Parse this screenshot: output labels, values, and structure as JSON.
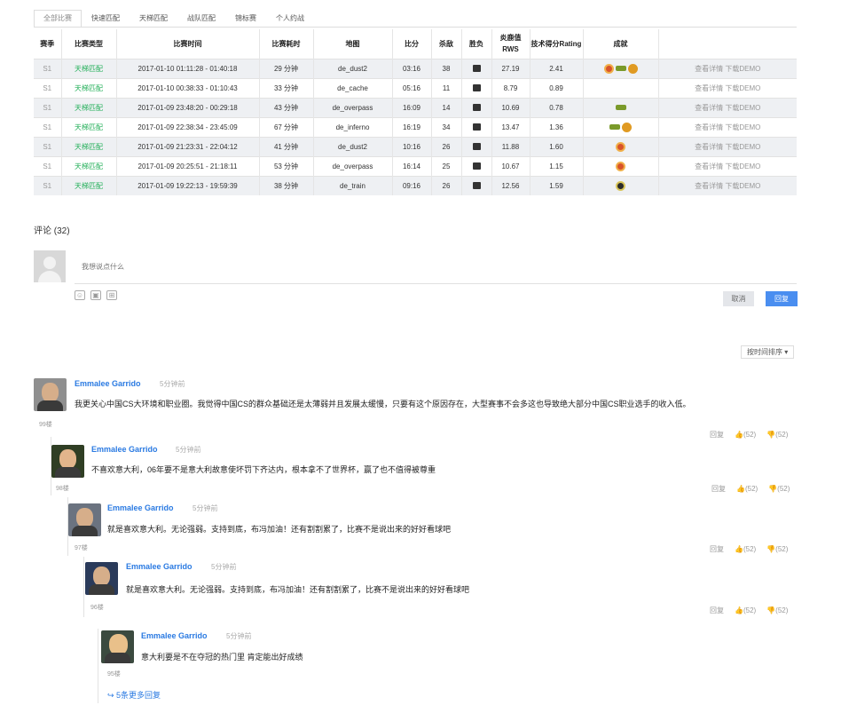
{
  "tabs": [
    "全部比赛",
    "快速匹配",
    "天梯匹配",
    "战队匹配",
    "锦标赛",
    "个人约战"
  ],
  "table": {
    "headers": [
      "赛季",
      "比赛类型",
      "比赛时间",
      "比赛耗时",
      "地图",
      "比分",
      "杀敌",
      "胜负",
      "炎鹿值RWS",
      "技术得分Rating",
      "成就",
      ""
    ],
    "rows": [
      {
        "season": "S1",
        "type": "天梯匹配",
        "time": "2017-01-10 01:11:28 - 01:40:18",
        "duration": "29 分钟",
        "map": "de_dust2",
        "score": "03:16",
        "kills": "38",
        "result": "car",
        "rws": "27.19",
        "rating": "2.41",
        "badges": [
          "red",
          "knife",
          "gold"
        ],
        "links": "查看详情  下载DEMO"
      },
      {
        "season": "S1",
        "type": "天梯匹配",
        "time": "2017-01-10 00:38:33 - 01:10:43",
        "duration": "33 分钟",
        "map": "de_cache",
        "score": "05:16",
        "kills": "11",
        "result": "car",
        "rws": "8.79",
        "rating": "0.89",
        "badges": [],
        "links": "查看详情  下载DEMO"
      },
      {
        "season": "S1",
        "type": "天梯匹配",
        "time": "2017-01-09 23:48:20 - 00:29:18",
        "duration": "43 分钟",
        "map": "de_overpass",
        "score": "16:09",
        "kills": "14",
        "result": "car",
        "rws": "10.69",
        "rating": "0.78",
        "badges": [
          "knife"
        ],
        "links": "查看详情  下载DEMO"
      },
      {
        "season": "S1",
        "type": "天梯匹配",
        "time": "2017-01-09 22:38:34 - 23:45:09",
        "duration": "67 分钟",
        "map": "de_inferno",
        "score": "16:19",
        "kills": "34",
        "result": "car",
        "rws": "13.47",
        "rating": "1.36",
        "badges": [
          "knife",
          "gold"
        ],
        "links": "查看详情  下载DEMO"
      },
      {
        "season": "S1",
        "type": "天梯匹配",
        "time": "2017-01-09 21:23:31 - 22:04:12",
        "duration": "41 分钟",
        "map": "de_dust2",
        "score": "10:16",
        "kills": "26",
        "result": "car",
        "rws": "11.88",
        "rating": "1.60",
        "badges": [
          "red"
        ],
        "links": "查看详情  下载DEMO"
      },
      {
        "season": "S1",
        "type": "天梯匹配",
        "time": "2017-01-09 20:25:51 - 21:18:11",
        "duration": "53 分钟",
        "map": "de_overpass",
        "score": "16:14",
        "kills": "25",
        "result": "car",
        "rws": "10.67",
        "rating": "1.15",
        "badges": [
          "red"
        ],
        "links": "查看详情  下载DEMO"
      },
      {
        "season": "S1",
        "type": "天梯匹配",
        "time": "2017-01-09 19:22:13 - 19:59:39",
        "duration": "38 分钟",
        "map": "de_train",
        "score": "09:16",
        "kills": "26",
        "result": "car",
        "rws": "12.56",
        "rating": "1.59",
        "badges": [
          "dark"
        ],
        "links": "查看详情  下载DEMO"
      }
    ]
  },
  "comments_section": {
    "title": "评论 (32)",
    "input_placeholder": "我想说点什么",
    "cancel_label": "取消",
    "send_label": "回复",
    "sort_label": "按时间排序 ▾"
  },
  "comments": [
    {
      "name": "Emmalee Garrido",
      "time": "5分钟前",
      "text": "我更关心中国CS大环境和职业圈。我觉得中国CS的群众基础还是太薄弱并且发展太缓慢，只要有这个原因存在，大型赛事不会多这也导致绝大部分中国CS职业选手的收入低。",
      "floor": "99楼",
      "reply": "回复",
      "likes": "(52)",
      "dislikes": "(52)"
    },
    {
      "name": "Emmalee Garrido",
      "time": "5分钟前",
      "text": "不喜欢意大利，06年要不是意大利故意使坏罚下齐达内，根本拿不了世界杯，赢了也不值得被尊重",
      "floor": "98楼",
      "reply": "回复",
      "likes": "(52)",
      "dislikes": "(52)"
    },
    {
      "name": "Emmalee Garrido",
      "time": "5分钟前",
      "text": "就是喜欢意大利。无论强弱。支持到底，布冯加油！还有割割累了，比赛不是说出来的好好看球吧",
      "floor": "97楼",
      "reply": "回复",
      "likes": "(52)",
      "dislikes": "(52)"
    },
    {
      "name": "Emmalee Garrido",
      "time": "5分钟前",
      "text": "就是喜欢意大利。无论强弱。支持到底，布冯加油！还有割割累了，比赛不是说出来的好好看球吧",
      "floor": "96楼",
      "reply": "回复",
      "likes": "(52)",
      "dislikes": "(52)"
    },
    {
      "name": "Emmalee Garrido",
      "time": "5分钟前",
      "text": "意大利要是不在夺冠的热门里 肯定能出好成绩",
      "floor": "95楼"
    }
  ],
  "more_replies": "↪ 5条更多回复"
}
